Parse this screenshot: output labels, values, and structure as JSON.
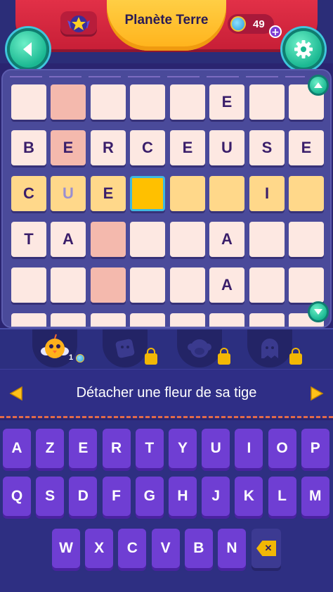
{
  "header": {
    "title": "Planète Terre",
    "coins": "49",
    "plus": "+",
    "back_icon": "chevron-left-icon",
    "settings_icon": "gear-icon",
    "badge_icon": "star-badge-icon"
  },
  "board": {
    "rows": [
      [
        {
          "l": "",
          "t": "plain"
        },
        {
          "l": "",
          "t": "pink"
        },
        {
          "l": "",
          "t": "plain"
        },
        {
          "l": "",
          "t": "plain"
        },
        {
          "l": "",
          "t": "plain"
        },
        {
          "l": "E",
          "t": "plain"
        },
        {
          "l": "",
          "t": "plain"
        },
        {
          "l": "",
          "t": "plain"
        }
      ],
      [
        {
          "l": "B",
          "t": "plain"
        },
        {
          "l": "E",
          "t": "pink"
        },
        {
          "l": "R",
          "t": "plain"
        },
        {
          "l": "C",
          "t": "plain"
        },
        {
          "l": "E",
          "t": "plain"
        },
        {
          "l": "U",
          "t": "plain"
        },
        {
          "l": "S",
          "t": "plain"
        },
        {
          "l": "E",
          "t": "plain"
        }
      ],
      [
        {
          "l": "C",
          "t": "row"
        },
        {
          "l": "U",
          "t": "row-hint"
        },
        {
          "l": "E",
          "t": "row"
        },
        {
          "l": "",
          "t": "sel"
        },
        {
          "l": "",
          "t": "row"
        },
        {
          "l": "",
          "t": "row"
        },
        {
          "l": "I",
          "t": "row"
        },
        {
          "l": "",
          "t": "row"
        }
      ],
      [
        {
          "l": "T",
          "t": "plain"
        },
        {
          "l": "A",
          "t": "plain"
        },
        {
          "l": "",
          "t": "pink"
        },
        {
          "l": "",
          "t": "plain"
        },
        {
          "l": "",
          "t": "plain"
        },
        {
          "l": "A",
          "t": "plain"
        },
        {
          "l": "",
          "t": "plain"
        },
        {
          "l": "",
          "t": "plain"
        }
      ],
      [
        {
          "l": "",
          "t": "plain"
        },
        {
          "l": "",
          "t": "plain"
        },
        {
          "l": "",
          "t": "pink"
        },
        {
          "l": "",
          "t": "plain"
        },
        {
          "l": "",
          "t": "plain"
        },
        {
          "l": "A",
          "t": "plain"
        },
        {
          "l": "",
          "t": "plain"
        },
        {
          "l": "",
          "t": "plain"
        }
      ]
    ],
    "scroll_up_icon": "chevron-up-icon",
    "scroll_down_icon": "chevron-down-icon"
  },
  "helpers": [
    {
      "name": "helper-bird",
      "count": "1",
      "locked": false
    },
    {
      "name": "helper-dice",
      "locked": true
    },
    {
      "name": "helper-monkey",
      "locked": true
    },
    {
      "name": "helper-ghost",
      "locked": true
    }
  ],
  "clue": {
    "text": "Détacher une fleur de sa tige",
    "prev_icon": "triangle-left-icon",
    "next_icon": "triangle-right-icon"
  },
  "keyboard": {
    "row1": [
      "A",
      "Z",
      "E",
      "R",
      "T",
      "Y",
      "U",
      "I",
      "O",
      "P"
    ],
    "row2": [
      "Q",
      "S",
      "D",
      "F",
      "G",
      "H",
      "J",
      "K",
      "L",
      "M"
    ],
    "row3": [
      "W",
      "X",
      "C",
      "V",
      "B",
      "N"
    ],
    "backspace_icon": "backspace-icon"
  },
  "colors": {
    "key": "#6f3ed3",
    "accent_green": "#1bb892",
    "header_red": "#e6334a",
    "title_yellow": "#ffd24a"
  }
}
